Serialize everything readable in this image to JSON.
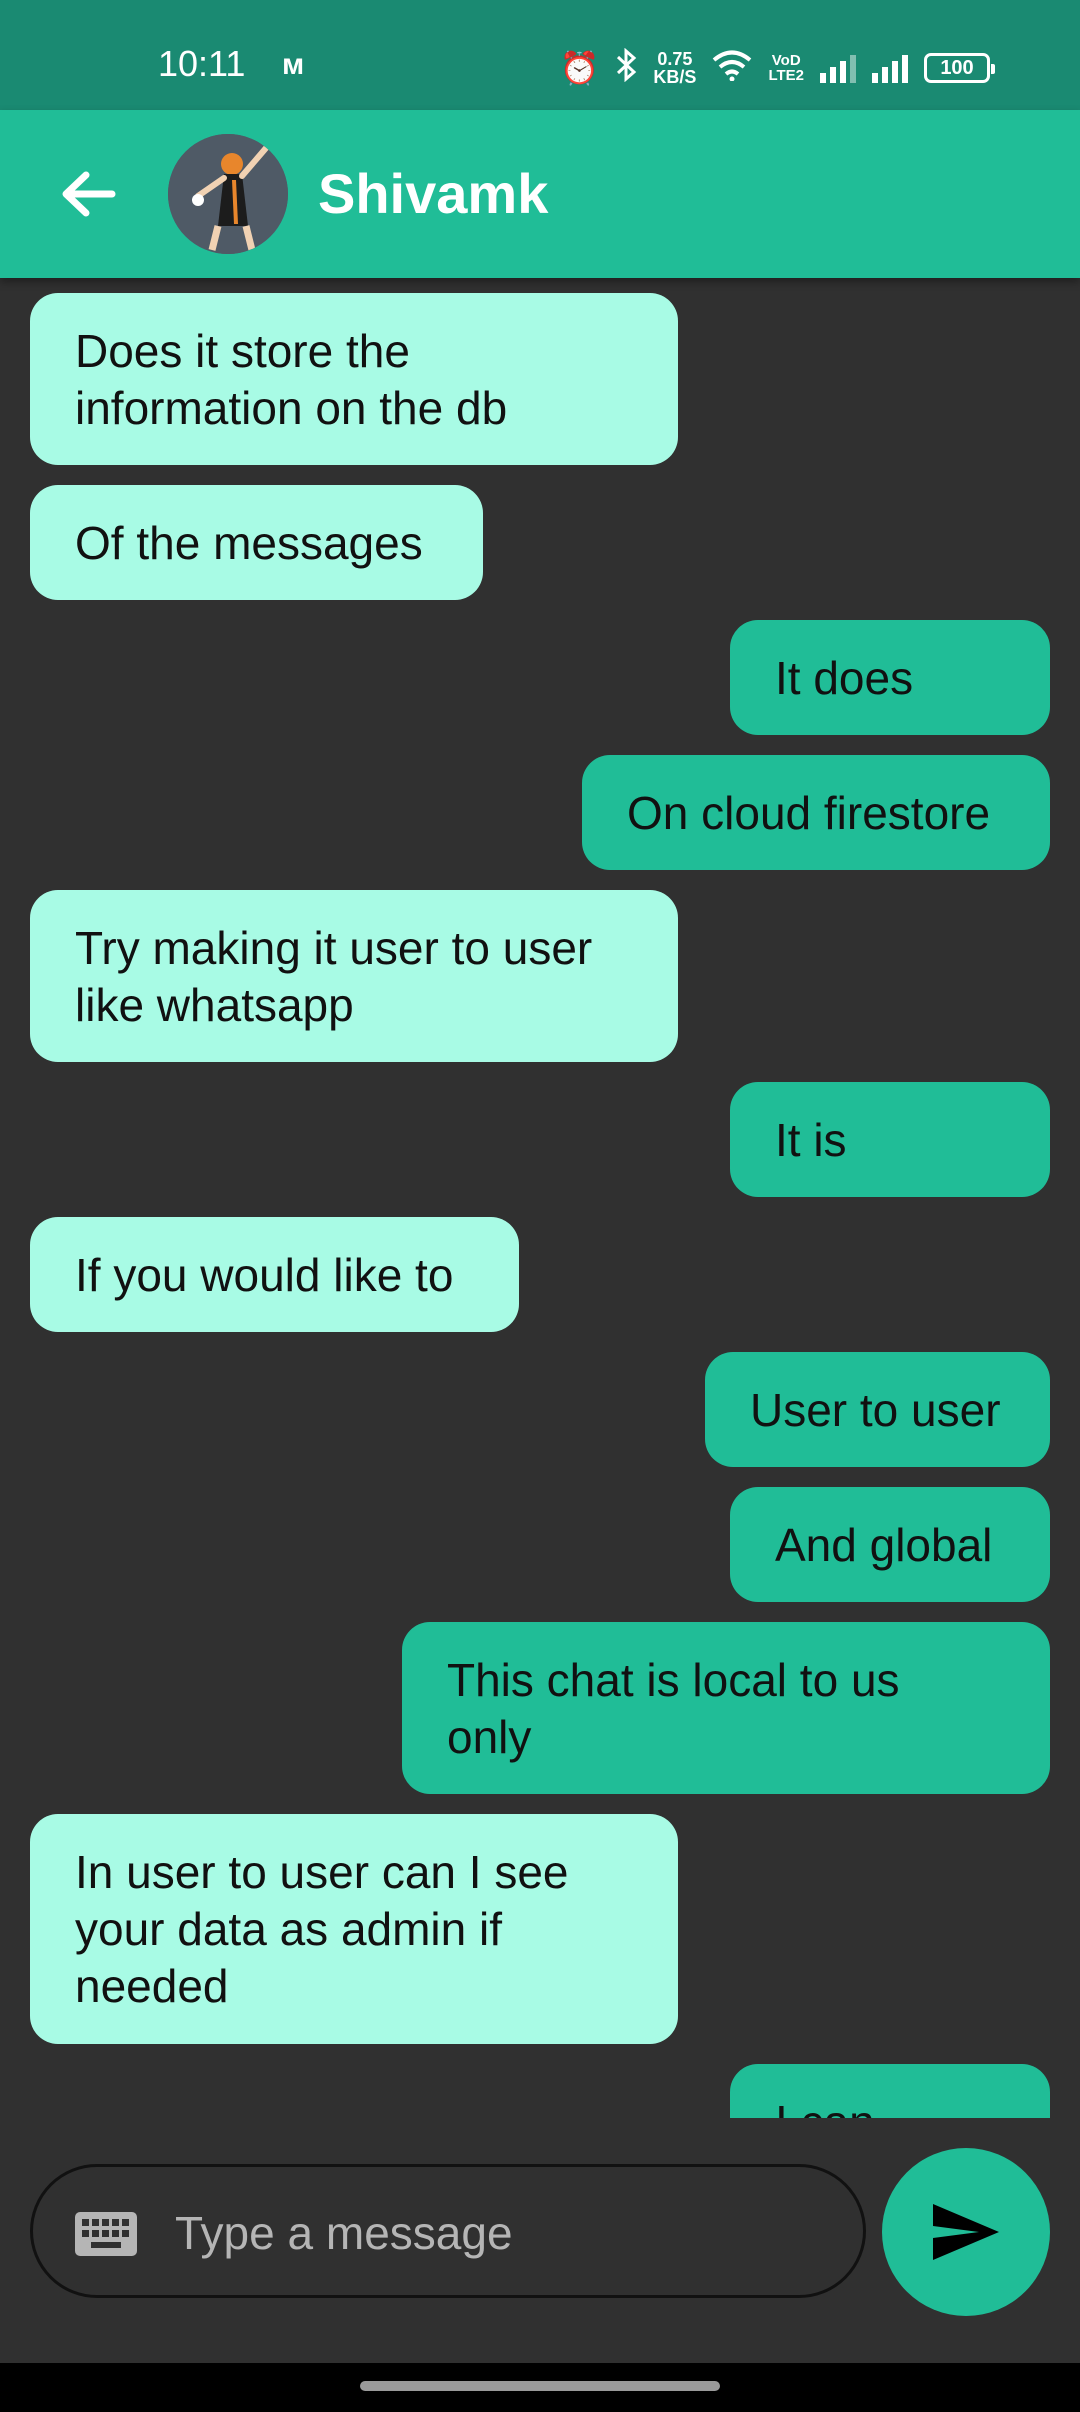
{
  "status_bar": {
    "time": "10:11",
    "net_speed_value": "0.75",
    "net_speed_unit": "KB/S",
    "volte_line1": "VoD",
    "volte_line2": "LTE2",
    "battery": "100"
  },
  "header": {
    "contact_name": "Shivamk"
  },
  "messages": [
    {
      "text": "Does it store the\ninformation on the db",
      "direction": "incoming"
    },
    {
      "text": "Of the messages",
      "direction": "incoming"
    },
    {
      "text": "It does",
      "direction": "outgoing"
    },
    {
      "text": "On cloud firestore",
      "direction": "outgoing"
    },
    {
      "text": "Try making it user to user\nlike whatsapp",
      "direction": "incoming"
    },
    {
      "text": "It is",
      "direction": "outgoing"
    },
    {
      "text": "If you would like to",
      "direction": "incoming"
    },
    {
      "text": "User to user",
      "direction": "outgoing"
    },
    {
      "text": "And global",
      "direction": "outgoing"
    },
    {
      "text": "This chat is local to us\nonly",
      "direction": "outgoing"
    },
    {
      "text": "In user to user can I see\nyour data as admin if\nneeded",
      "direction": "incoming"
    },
    {
      "text": "I can",
      "direction": "outgoing"
    }
  ],
  "composer": {
    "placeholder": "Type a message"
  },
  "colors": {
    "status_bar": "#1a8a72",
    "app_bar": "#20bd97",
    "incoming_bubble": "#a8fbe5",
    "outgoing_bubble": "#20bd97",
    "background": "#303030"
  },
  "icons": {
    "back": "arrow-left-icon",
    "keyboard": "keyboard-icon",
    "send": "send-icon",
    "alarm": "alarm-icon",
    "bluetooth": "bluetooth-icon",
    "wifi": "wifi-icon"
  }
}
